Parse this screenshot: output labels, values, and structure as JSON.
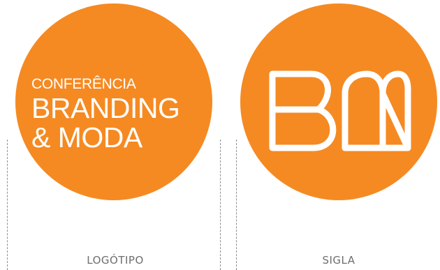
{
  "brand": {
    "accent_color": "#f58a22",
    "text_color": "#ffffff",
    "caption_color": "#6e6e6e"
  },
  "logotipo": {
    "line1": "CONFERÊNCIA",
    "line2": "BRANDING",
    "line3": "& MODA",
    "caption": "LOGÓTIPO"
  },
  "sigla": {
    "monogram": "BM",
    "caption": "SIGLA"
  }
}
